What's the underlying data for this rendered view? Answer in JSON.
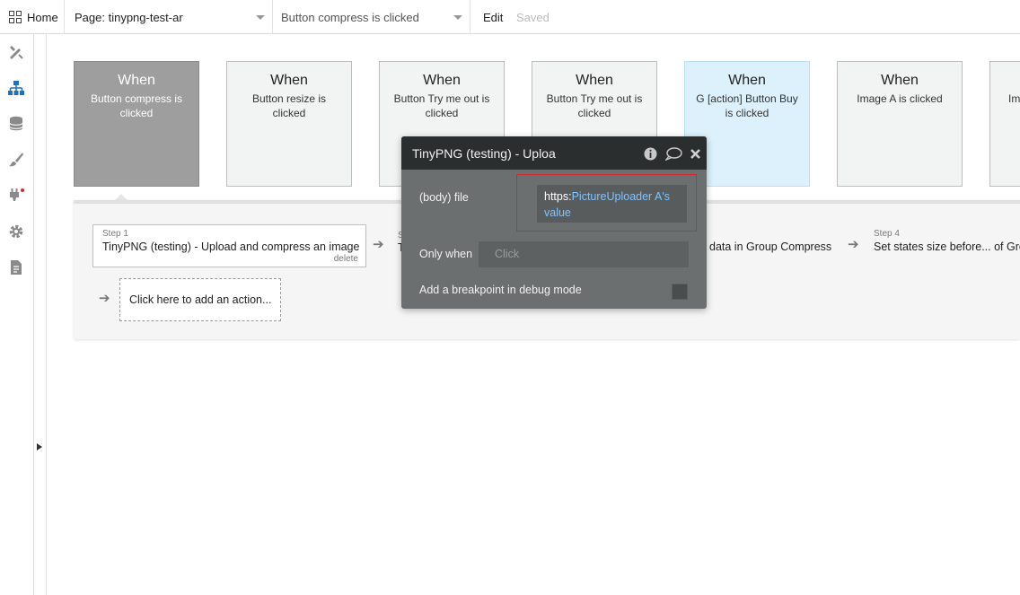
{
  "topbar": {
    "home_label": "Home",
    "page_label": "Page: tinypng-test-ar",
    "event_label": "Button compress is clicked",
    "edit_label": "Edit",
    "saved_label": "Saved"
  },
  "sidebar_icons": [
    "design-icon",
    "workflow-icon",
    "data-icon",
    "styles-icon",
    "plugins-icon",
    "settings-icon",
    "logs-icon"
  ],
  "events": [
    {
      "when": "When",
      "desc": "Button compress is clicked",
      "state": "selected"
    },
    {
      "when": "When",
      "desc": "Button resize is clicked",
      "state": "normal"
    },
    {
      "when": "When",
      "desc": "Button Try me out is clicked",
      "state": "normal"
    },
    {
      "when": "When",
      "desc": "Button Try me out is clicked",
      "state": "normal"
    },
    {
      "when": "When",
      "desc": "G [action] Button Buy is clicked",
      "state": "highlighted"
    },
    {
      "when": "When",
      "desc": "Image A is clicked",
      "state": "normal"
    },
    {
      "when": "",
      "desc": "Im",
      "state": "normal"
    }
  ],
  "workflow": {
    "step1": {
      "label": "Step 1",
      "title": "TinyPNG (testing) - Upload and compress an image",
      "delete": "delete"
    },
    "step2_partial": {
      "label": "S",
      "title": "T"
    },
    "step3_partial": {
      "title": "data in Group Compress"
    },
    "step4": {
      "label": "Step 4",
      "title": "Set states size before... of Gro"
    },
    "add_action": "Click here to add an action..."
  },
  "editor": {
    "title": "TinyPNG (testing) - Uploa",
    "body_file_label": "(body) file",
    "body_file_prefix": "https:",
    "body_file_dynamic": "PictureUploader A's value",
    "only_when_label": "Only when",
    "only_when_placeholder": "Click",
    "breakpoint_label": "Add a breakpoint in debug mode"
  },
  "colors": {
    "selected_card": "#9e9e9e",
    "highlighted_card": "#dcf1fb",
    "editor_bg": "#6b6f70",
    "editor_header": "#2b2e2f",
    "dynamic_text": "#7fc3ff",
    "outline_red": "#d6262f",
    "rail_icon_blue": "#1f6fc5"
  }
}
